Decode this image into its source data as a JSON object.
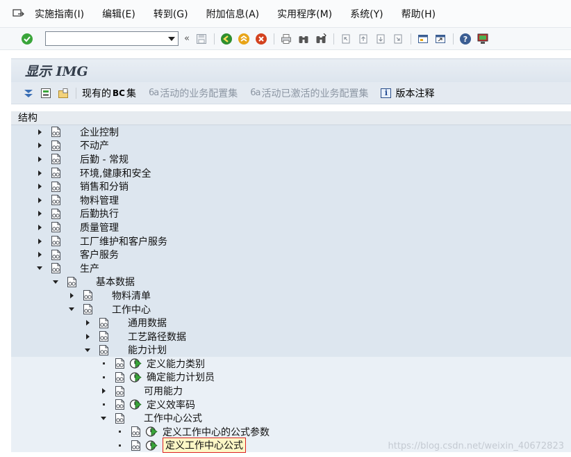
{
  "menubar": {
    "items": [
      "实施指南(I)",
      "编辑(E)",
      "转到(G)",
      "附加信息(A)",
      "实用程序(M)",
      "系统(Y)",
      "帮助(H)"
    ]
  },
  "systoolbar": {
    "command_value": "",
    "double_chevron": "«"
  },
  "title": "显示 IMG",
  "apptoolbar": {
    "current_bc": "现有的",
    "bc_set": "BC",
    "bc_suffix": "集",
    "active_projects": "活动的业务配置集",
    "activated_projects": "活动已激活的业务配置集",
    "release_notes": "版本注释"
  },
  "structure": {
    "header": "结构",
    "rows": [
      {
        "label": "企业控制",
        "level": 0,
        "toggle": "collapsed",
        "exec": false
      },
      {
        "label": "不动产",
        "level": 0,
        "toggle": "collapsed",
        "exec": false
      },
      {
        "label": "后勤 - 常规",
        "level": 0,
        "toggle": "collapsed",
        "exec": false
      },
      {
        "label": "环境,健康和安全",
        "level": 0,
        "toggle": "collapsed",
        "exec": false
      },
      {
        "label": "销售和分销",
        "level": 0,
        "toggle": "collapsed",
        "exec": false
      },
      {
        "label": "物料管理",
        "level": 0,
        "toggle": "collapsed",
        "exec": false
      },
      {
        "label": "后勤执行",
        "level": 0,
        "toggle": "collapsed",
        "exec": false
      },
      {
        "label": "质量管理",
        "level": 0,
        "toggle": "collapsed",
        "exec": false
      },
      {
        "label": "工厂维护和客户服务",
        "level": 0,
        "toggle": "collapsed",
        "exec": false
      },
      {
        "label": "客户服务",
        "level": 0,
        "toggle": "collapsed",
        "exec": false
      },
      {
        "label": "生产",
        "level": 0,
        "toggle": "expanded",
        "exec": false
      },
      {
        "label": "基本数据",
        "level": 1,
        "toggle": "expanded",
        "exec": false
      },
      {
        "label": "物料清单",
        "level": 2,
        "toggle": "collapsed",
        "exec": false
      },
      {
        "label": "工作中心",
        "level": 2,
        "toggle": "expanded",
        "exec": false
      },
      {
        "label": "通用数据",
        "level": 3,
        "toggle": "collapsed",
        "exec": false
      },
      {
        "label": "工艺路径数据",
        "level": 3,
        "toggle": "collapsed",
        "exec": false
      },
      {
        "label": "能力计划",
        "level": 3,
        "toggle": "expanded",
        "exec": false
      },
      {
        "label": "定义能力类别",
        "level": 4,
        "toggle": "leaf",
        "exec": true
      },
      {
        "label": "确定能力计划员",
        "level": 4,
        "toggle": "leaf",
        "exec": true
      },
      {
        "label": "可用能力",
        "level": 4,
        "toggle": "collapsed",
        "exec": false
      },
      {
        "label": "定义效率码",
        "level": 4,
        "toggle": "leaf",
        "exec": true
      },
      {
        "label": "工作中心公式",
        "level": 4,
        "toggle": "expanded",
        "exec": false
      },
      {
        "label": "定义工作中心的公式参数",
        "level": 5,
        "toggle": "leaf",
        "exec": true
      },
      {
        "label": "定义工作中心公式",
        "level": 5,
        "toggle": "leaf",
        "exec": true,
        "selected": true
      }
    ]
  },
  "watermark": "https://blog.csdn.net/weixin_40672823",
  "colors": {
    "ok_green": "#3aa53a",
    "back_green": "#2f8f2f",
    "exit_orange": "#e8a418",
    "cancel_red": "#d3421e",
    "selection_border": "#dd2222"
  }
}
